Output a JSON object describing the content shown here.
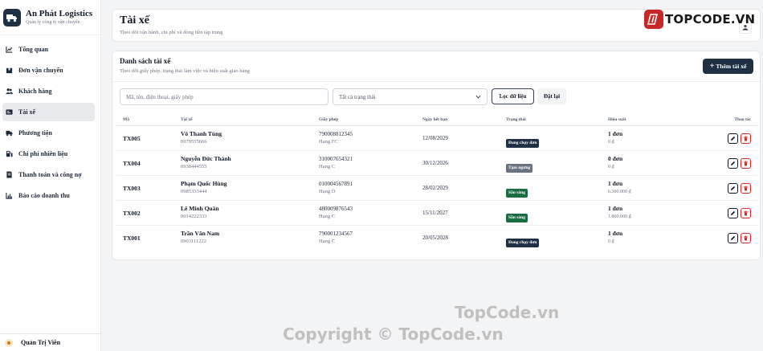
{
  "brand": {
    "name": "An Phát Logistics",
    "subtitle": "Quản lý công ty vận chuyển"
  },
  "sidebar": {
    "items": [
      {
        "label": "Tổng quan",
        "icon": "chart-line-icon",
        "active": false
      },
      {
        "label": "Đơn vận chuyển",
        "icon": "package-icon",
        "active": false
      },
      {
        "label": "Khách hàng",
        "icon": "users-icon",
        "active": false
      },
      {
        "label": "Tài xế",
        "icon": "id-card-icon",
        "active": true
      },
      {
        "label": "Phương tiện",
        "icon": "truck-icon",
        "active": false
      },
      {
        "label": "Chi phí nhiên liệu",
        "icon": "fuel-icon",
        "active": false
      },
      {
        "label": "Thanh toán và công nợ",
        "icon": "receipt-icon",
        "active": false
      },
      {
        "label": "Báo cáo doanh thu",
        "icon": "bar-chart-icon",
        "active": false
      }
    ],
    "user": {
      "name": "Quản Trị Viên"
    }
  },
  "header": {
    "title": "Tài xế",
    "subtitle": "Theo dõi vận hành, chi phí và dòng tiền tập trung"
  },
  "watermark": {
    "badge": "TOPCODE.VN",
    "mid": "TopCode.vn",
    "copyright": "Copyright © TopCode.vn"
  },
  "section": {
    "title": "Danh sách tài xế",
    "subtitle": "Theo dõi giấy phép, trạng thái làm việc và hiệu suất giao hàng",
    "add_label": "Thêm tài xế"
  },
  "filters": {
    "search_placeholder": "Mã, tên, điện thoại, giấy phép",
    "status_selected": "Tất cả trạng thái",
    "filter_label": "Lọc dữ liệu",
    "reset_label": "Đặt lại"
  },
  "table": {
    "columns": [
      "Mã",
      "Tài xế",
      "Giấy phép",
      "Ngày hết hạn",
      "Trạng thái",
      "Hiệu suất",
      "Thao tác"
    ],
    "rows": [
      {
        "id": "TX005",
        "name": "Võ Thanh Tùng",
        "phone": "0979555666",
        "license": "790008812345",
        "class": "Hạng FC",
        "expiry": "12/08/2029",
        "status": "Đang chạy đơn",
        "status_color": "#1f3045",
        "orders": "1 đơn",
        "revenue": "0 ₫"
      },
      {
        "id": "TX004",
        "name": "Nguyễn Đức Thành",
        "phone": "0938444555",
        "license": "310007654321",
        "class": "Hạng C",
        "expiry": "30/12/2026",
        "status": "Tạm ngưng",
        "status_color": "#6b7280",
        "orders": "0 đơn",
        "revenue": "0 ₫"
      },
      {
        "id": "TX003",
        "name": "Phạm Quốc Hùng",
        "phone": "0985333444",
        "license": "010004567891",
        "class": "Hạng D",
        "expiry": "28/02/2029",
        "status": "Sẵn sàng",
        "status_color": "#1b6b43",
        "orders": "1 đơn",
        "revenue": "6.300.000 ₫"
      },
      {
        "id": "TX002",
        "name": "Lê Minh Quân",
        "phone": "0914222333",
        "license": "480009876543",
        "class": "Hạng C",
        "expiry": "15/11/2027",
        "status": "Sẵn sàng",
        "status_color": "#1b6b43",
        "orders": "1 đơn",
        "revenue": "1.800.000 ₫"
      },
      {
        "id": "TX001",
        "name": "Trần Văn Nam",
        "phone": "0903111222",
        "license": "790001234567",
        "class": "Hạng C",
        "expiry": "20/05/2028",
        "status": "Đang chạy đơn",
        "status_color": "#1f3045",
        "orders": "1 đơn",
        "revenue": "0 ₫"
      }
    ]
  }
}
